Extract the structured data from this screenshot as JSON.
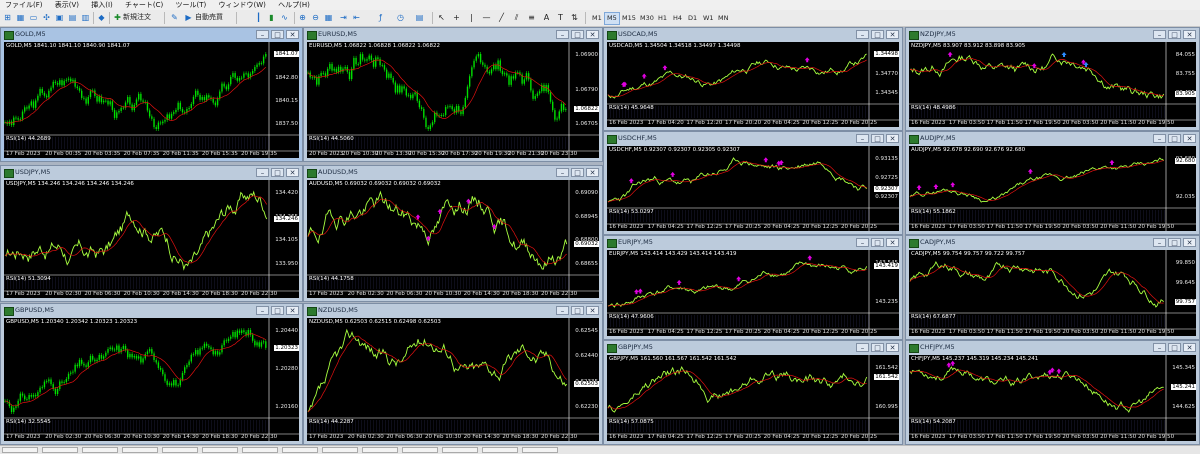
{
  "menu": [
    "ファイル(F)",
    "表示(V)",
    "挿入(I)",
    "チャート(C)",
    "ツール(T)",
    "ウィンドウ(W)",
    "ヘルプ(H)"
  ],
  "toolbar": {
    "new_order": "新規注文",
    "auto_trade": "自動売買",
    "timeframes": [
      "M1",
      "M5",
      "M15",
      "M30",
      "H1",
      "H4",
      "D1",
      "W1",
      "MN"
    ],
    "active_timeframe": "M5"
  },
  "colors": {
    "chart_bg": "#000000",
    "candle": "#00e000",
    "line": "#a8ff40",
    "ma": "#e01010",
    "arrow_up": "#e000e0",
    "arrow_blue": "#2a8cff"
  },
  "windows": [
    {
      "title": "GOLD,M5",
      "ohlc": "GOLD,M5  1841.10 1841.10 1840.90 1841.07",
      "rsi": "RSI(14) 44.2689",
      "prices": [
        "1845.65",
        "1842.80",
        "1840.15",
        "1837.50"
      ],
      "tag": "1841.07",
      "times": [
        "17 Feb 2023",
        "20 Feb 00:35",
        "20 Feb 03:35",
        "20 Feb 07:35",
        "20 Feb 11:35",
        "20 Feb 15:35",
        "20 Feb 19:35"
      ]
    },
    {
      "title": "EURUSD,M5",
      "ohlc": "EURUSD,M5  1.06822 1.06828 1.06822 1.06822",
      "rsi": "RSI(14) 44.5060",
      "prices": [
        "1.06900",
        "1.06790",
        "1.06705"
      ],
      "tag": "1.06822",
      "times": [
        "20 Feb 2023",
        "20 Feb 10:30",
        "20 Feb 13:30",
        "20 Feb 15:30",
        "20 Feb 17:30",
        "20 Feb 19:30",
        "20 Feb 21:30",
        "20 Feb 23:30"
      ]
    },
    {
      "title": "USDCAD,M5",
      "ohlc": "USDCAD,M5  1.34504 1.34518 1.34497 1.34498",
      "rsi": "RSI(14) 45.9648",
      "prices": [
        "1.35190",
        "1.34770",
        "1.34345"
      ],
      "tag": "1.34498",
      "times": [
        "16 Feb 2023",
        "17 Feb 04:20",
        "17 Feb 12:20",
        "17 Feb 20:20",
        "20 Feb 04:25",
        "20 Feb 12:25",
        "20 Feb 20:25"
      ]
    },
    {
      "title": "NZDJPY,M5",
      "ohlc": "NZDJPY,M5  83.907 83.912 83.898 83.905",
      "rsi": "RSI(14) 48.4986",
      "prices": [
        "84.055",
        "83.755",
        "83.455"
      ],
      "tag": "83.905",
      "times": [
        "16 Feb 2023",
        "17 Feb 03:50",
        "17 Feb 11:50",
        "17 Feb 19:50",
        "20 Feb 03:50",
        "20 Feb 11:50",
        "20 Feb 19:50"
      ]
    },
    {
      "title": "USDJPY,M5",
      "ohlc": "USDJPY,M5  134.246 134.246 134.246 134.246",
      "rsi": "RSI(14) 51.3094",
      "prices": [
        "134.420",
        "134.265",
        "134.105",
        "133.950"
      ],
      "tag": "134.246",
      "times": [
        "17 Feb 2023",
        "20 Feb 02:30",
        "20 Feb 06:30",
        "20 Feb 10:30",
        "20 Feb 14:30",
        "20 Feb 18:30",
        "20 Feb 22:30"
      ]
    },
    {
      "title": "AUDUSD,M5",
      "ohlc": "AUDUSD,M5  0.69032 0.69032 0.69032 0.69032",
      "rsi": "RSI(14) 44.1758",
      "prices": [
        "0.69090",
        "0.68945",
        "0.68800",
        "0.68655"
      ],
      "tag": "0.69032",
      "times": [
        "17 Feb 2023",
        "20 Feb 02:30",
        "20 Feb 06:30",
        "20 Feb 10:30",
        "20 Feb 14:30",
        "20 Feb 18:30",
        "20 Feb 22:30"
      ]
    },
    {
      "title": "USDCHF,M5",
      "ohlc": "USDCHF,M5  0.92307 0.92307 0.92305 0.92307",
      "rsi": "RSI(14) 53.0297",
      "prices": [
        "0.93135",
        "0.92725",
        "0.92307"
      ],
      "tag": "0.92307",
      "times": [
        "16 Feb 2023",
        "17 Feb 04:25",
        "17 Feb 12:25",
        "17 Feb 20:25",
        "20 Feb 04:25",
        "20 Feb 12:25",
        "20 Feb 20:25"
      ]
    },
    {
      "title": "AUDJPY,M5",
      "ohlc": "AUDJPY,M5  92.678 92.690 92.676 92.680",
      "rsi": "RSI(14) 55.1862",
      "prices": [
        "92.680",
        "92.035"
      ],
      "tag": "92.680",
      "times": [
        "16 Feb 2023",
        "17 Feb 03:50",
        "17 Feb 11:50",
        "17 Feb 19:50",
        "20 Feb 03:50",
        "20 Feb 11:50",
        "20 Feb 19:50"
      ]
    },
    {
      "title": "GBPUSD,M5",
      "ohlc": "GBPUSD,M5  1.20340 1.20342 1.20323 1.20323",
      "rsi": "RSI(14) 32.5545",
      "prices": [
        "1.20440",
        "1.20280",
        "1.20160"
      ],
      "tag": "1.20323",
      "times": [
        "17 Feb 2023",
        "20 Feb 02:30",
        "20 Feb 06:30",
        "20 Feb 10:30",
        "20 Feb 14:30",
        "20 Feb 18:30",
        "20 Feb 22:30"
      ]
    },
    {
      "title": "NZDUSD,M5",
      "ohlc": "NZDUSD,M5  0.62503 0.62515 0.62498 0.62503",
      "rsi": "RSI(14) 44.2287",
      "prices": [
        "0.62545",
        "0.62440",
        "0.62335",
        "0.62230"
      ],
      "tag": "0.62503",
      "times": [
        "17 Feb 2023",
        "20 Feb 02:30",
        "20 Feb 06:30",
        "20 Feb 10:30",
        "20 Feb 14:30",
        "20 Feb 18:30",
        "20 Feb 22:30"
      ]
    },
    {
      "title": "EURJPY,M5",
      "ohlc": "EURJPY,M5  143.414 143.429 143.414 143.419",
      "rsi": "RSI(14) 47.9606",
      "prices": [
        "143.545",
        "143.235"
      ],
      "tag": "143.419",
      "times": [
        "16 Feb 2023",
        "17 Feb 04:25",
        "17 Feb 12:25",
        "17 Feb 20:25",
        "20 Feb 04:25",
        "20 Feb 12:25",
        "20 Feb 20:25"
      ]
    },
    {
      "title": "CADJPY,M5",
      "ohlc": "CADJPY,M5  99.754 99.757 99.722 99.757",
      "rsi": "RSI(14) 67.6877",
      "prices": [
        "99.850",
        "99.645",
        "99.445"
      ],
      "tag": "99.757",
      "times": [
        "16 Feb 2023",
        "17 Feb 03:50",
        "17 Feb 11:50",
        "17 Feb 19:50",
        "20 Feb 03:50",
        "20 Feb 11:50",
        "20 Feb 19:50"
      ]
    },
    {
      "title": "GBPJPY,M5",
      "ohlc": "GBPJPY,M5  161.560 161.567 161.542 161.542",
      "rsi": "RSI(14) 57.0875",
      "prices": [
        "161.542",
        "160.995"
      ],
      "tag": "161.542",
      "times": [
        "16 Feb 2023",
        "17 Feb 04:25",
        "17 Feb 12:25",
        "17 Feb 20:25",
        "20 Feb 04:25",
        "20 Feb 12:25",
        "20 Feb 20:25"
      ]
    },
    {
      "title": "CHFJPY,M5",
      "ohlc": "CHFJPY,M5  145.237 145.319 145.234 145.241",
      "rsi": "RSI(14) 54.2087",
      "prices": [
        "145.345",
        "144.985",
        "144.625"
      ],
      "tag": "145.241",
      "times": [
        "16 Feb 2023",
        "17 Feb 03:50",
        "17 Feb 11:50",
        "17 Feb 19:50",
        "20 Feb 03:50",
        "20 Feb 11:50",
        "20 Feb 19:50"
      ]
    }
  ]
}
